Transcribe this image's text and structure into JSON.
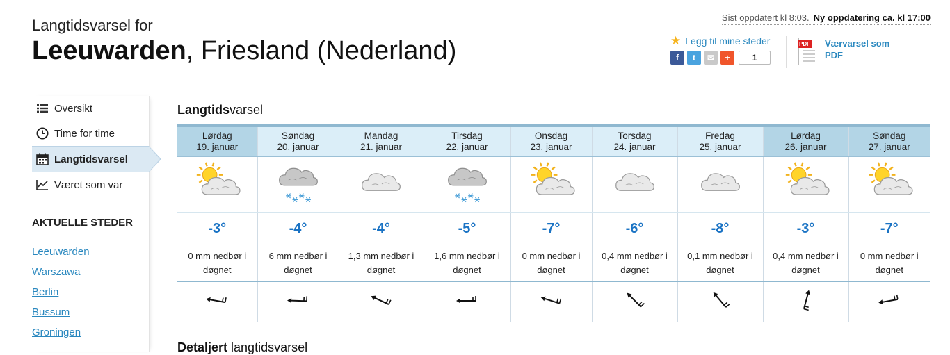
{
  "header": {
    "subtitle": "Langtidsvarsel for",
    "city": "Leeuwarden",
    "region": ", Friesland (Nederland)",
    "updated_label": "Sist oppdatert kl 8:03.",
    "next_update": "Ny oppdatering ca. kl 17:00",
    "favorite": "Legg til mine steder",
    "share_count": "1",
    "pdf_label": "Værvarsel som PDF",
    "pdf_tag": "PDF"
  },
  "sidebar": {
    "nav": [
      {
        "label": "Oversikt",
        "icon": "list-icon"
      },
      {
        "label": "Time for time",
        "icon": "clock-icon"
      },
      {
        "label": "Langtidsvarsel",
        "icon": "calendar-icon",
        "active": true
      },
      {
        "label": "Været som var",
        "icon": "chart-icon"
      }
    ],
    "places_title": "AKTUELLE STEDER",
    "places": [
      "Leeuwarden",
      "Warszawa",
      "Berlin",
      "Bussum",
      "Groningen"
    ]
  },
  "main": {
    "title_bold": "Langtids",
    "title_rest": "varsel",
    "lower_bold": "Detaljert",
    "lower_rest": " langtidsvarsel"
  },
  "forecast": [
    {
      "day": "Lørdag",
      "date": "19. januar",
      "weekend": true,
      "icon": "partly-cloudy",
      "temp": "-3°",
      "precip": "0 mm nedbør i døgnet",
      "wind_deg": 100
    },
    {
      "day": "Søndag",
      "date": "20. januar",
      "weekend": false,
      "icon": "cloud-snow",
      "temp": "-4°",
      "precip": "6 mm nedbør i døgnet",
      "wind_deg": 92
    },
    {
      "day": "Mandag",
      "date": "21. januar",
      "weekend": false,
      "icon": "cloudy",
      "temp": "-4°",
      "precip": "1,3 mm nedbør i døgnet",
      "wind_deg": 115
    },
    {
      "day": "Tirsdag",
      "date": "22. januar",
      "weekend": false,
      "icon": "cloud-snow",
      "temp": "-5°",
      "precip": "1,6 mm nedbør i døgnet",
      "wind_deg": 90
    },
    {
      "day": "Onsdag",
      "date": "23. januar",
      "weekend": false,
      "icon": "partly-cloudy",
      "temp": "-7°",
      "precip": "0 mm nedbør i døgnet",
      "wind_deg": 108
    },
    {
      "day": "Torsdag",
      "date": "24. januar",
      "weekend": false,
      "icon": "cloudy",
      "temp": "-6°",
      "precip": "0,4 mm nedbør i døgnet",
      "wind_deg": 135
    },
    {
      "day": "Fredag",
      "date": "25. januar",
      "weekend": false,
      "icon": "cloudy",
      "temp": "-8°",
      "precip": "0,1 mm nedbør i døgnet",
      "wind_deg": 140
    },
    {
      "day": "Lørdag",
      "date": "26. januar",
      "weekend": true,
      "icon": "partly-cloudy",
      "temp": "-3°",
      "precip": "0,4 mm nedbør i døgnet",
      "wind_deg": 195
    },
    {
      "day": "Søndag",
      "date": "27. januar",
      "weekend": true,
      "icon": "partly-cloudy",
      "temp": "-7°",
      "precip": "0 mm nedbør i døgnet",
      "wind_deg": 80
    }
  ],
  "colors": {
    "accent": "#2a88bf",
    "temp": "#1a73c4",
    "header_band": "#dbeef8",
    "weekend_band": "#b3d5e6"
  }
}
